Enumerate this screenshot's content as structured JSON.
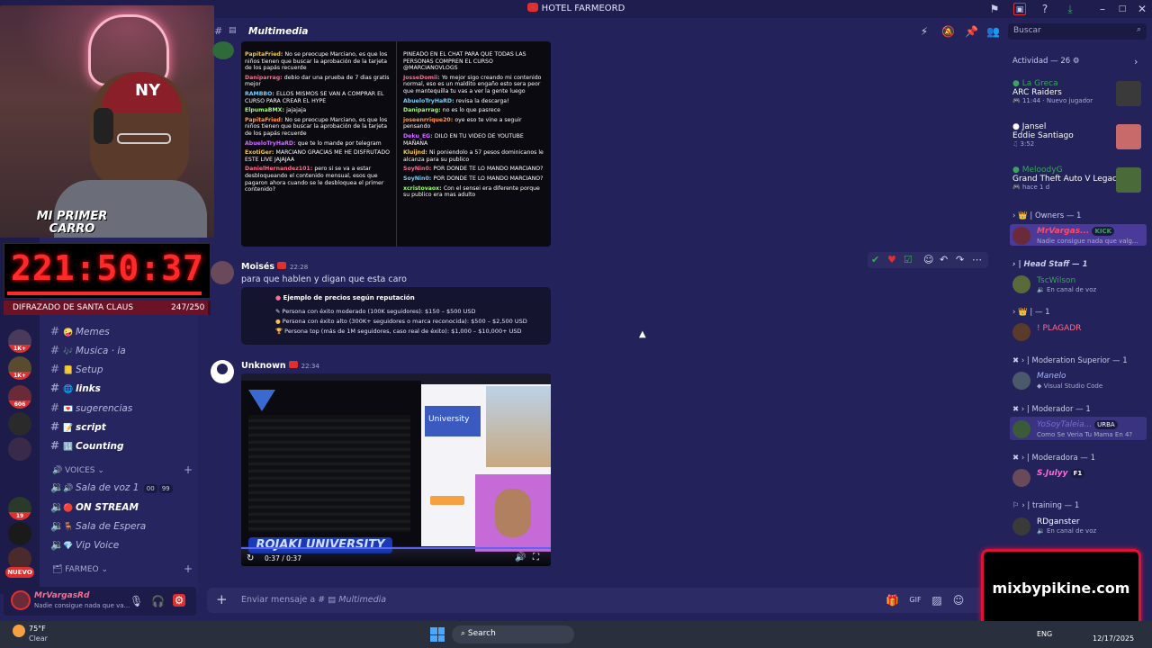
{
  "window": {
    "title": "HOTEL FARMEORD"
  },
  "channel_header": {
    "name": "Multimedia",
    "search_placeholder": "Buscar"
  },
  "stream_overlay": {
    "banner": "MI PRIMER CARRO",
    "timer": "221:50:37",
    "goal_label": "DIFRAZADO DE SANTA CLAUS",
    "goal_progress": "247/250",
    "goal_fraction": 0.988
  },
  "server_rail": {
    "badges": [
      "1K+",
      "1K+",
      "606",
      "19"
    ],
    "new_label": "NUEVO"
  },
  "channels": [
    {
      "emoji": "🤪",
      "name": "Memes",
      "bold": false
    },
    {
      "emoji": "🎶",
      "name": "Musica · ia",
      "bold": false
    },
    {
      "emoji": "📒",
      "name": "Setup",
      "bold": false
    },
    {
      "emoji": "🌐",
      "name": "links",
      "bold": true
    },
    {
      "emoji": "💌",
      "name": "sugerencias",
      "bold": false
    },
    {
      "emoji": "📝",
      "name": "script",
      "bold": true
    },
    {
      "emoji": "🔢",
      "name": "Counting",
      "bold": true
    }
  ],
  "voices_category": "VOICES",
  "voice_channels": [
    {
      "emoji": "🔊",
      "name": "Sala de voz 1",
      "count_a": "00",
      "count_b": "99"
    },
    {
      "emoji": "🔴",
      "name": "ON STREAM"
    },
    {
      "emoji": "🪑",
      "name": "Sala de Espera"
    },
    {
      "emoji": "💎",
      "name": "Vip Voice"
    }
  ],
  "farmeo_category": "FARMEO",
  "chat_log_left": [
    {
      "user": "PapitaFried",
      "text": "No se preocupe Marciano, es que los niños tienen que buscar la aprobación de la tarjeta de los papás recuerde"
    },
    {
      "user": "Daniparrag",
      "text": "debio dar una prueba de 7 dias gratis mejor"
    },
    {
      "user": "RAMBBO",
      "text": "ELLOS MISMOS SE VAN A COMPRAR EL CURSO PARA CREAR EL HYPE"
    },
    {
      "user": "ElpumaBMX",
      "text": "jajajaja"
    },
    {
      "user": "PapitaFried",
      "text": "No se preocupe Marciano, es que los niños tienen que buscar la aprobación de la tarjeta de los papás recuerde"
    },
    {
      "user": "AbueloTryHaRD",
      "text": "que te lo mande por telegram"
    },
    {
      "user": "ExotiGer",
      "text": "MARCIANO GRACIAS ME HE DISFRUTADO ESTE LIVE JAJAJAA"
    },
    {
      "user": "DanielHernandez101",
      "text": "pero si se va a estar desbloqueando el contenido mensual, esos que pagaron ahora cuando se le desbloquea el primer contenido?"
    }
  ],
  "chat_log_right": [
    {
      "user": "",
      "text": "PINEADO EN EL CHAT PARA QUE TODAS LAS PERSONAS COMPREN EL CURSO @MARCIANOVLOGS"
    },
    {
      "user": "JosseDomii",
      "text": "Yo mejor sigo creando mi contenido normal, eso es un maldito engaño esto sera peor que mantequilla tu vas a ver la gente luego"
    },
    {
      "user": "AbueloTryHaRD",
      "text": "revisa la descarga!"
    },
    {
      "user": "Daniparrag",
      "text": "no es lo que pasrece"
    },
    {
      "user": "joseenrrique20",
      "text": "oye eso te vine a seguir pensando"
    },
    {
      "user": "Deku_EG",
      "text": "DILO EN TU VIDEO DE YOUTUBE MAÑANA"
    },
    {
      "user": "Kluijnd",
      "text": "Ni poniendolo a 57 pesos dominicanos le alcanza para su publico"
    },
    {
      "user": "SoyNin0",
      "text": "POR DONDE TE LO MANDO MARCIANO?"
    },
    {
      "user": "SoyNin0",
      "text": "POR DONDE TE LO MANDO MARCIANO?"
    },
    {
      "user": "xcristovaox",
      "text": "Con el sensei era diferente porque su publico era mas adulto"
    }
  ],
  "messages": [
    {
      "author": "Moisés",
      "time": "22:28",
      "text": "para que hablen y digan que esta caro"
    },
    {
      "author": "Unknown",
      "time": "22:34",
      "text": ""
    }
  ],
  "price_card": {
    "title": "Ejemplo de precios según reputación",
    "rows": [
      "Persona con éxito moderado (100K seguidores): $150 – $500 USD",
      "Persona con éxito alto (300K+ seguidores o marca reconocida): $500 – $2,500 USD",
      "Persona top (más de 1M seguidores, caso real de éxito): $1,000 – $10,000+ USD"
    ]
  },
  "video": {
    "time": "0:37 / 0:37",
    "banner": "ROJAKI UNIVERSITY",
    "site_title": "University"
  },
  "composer": {
    "placeholder_prefix": "Enviar mensaje a #",
    "placeholder_channel": "Multimedia"
  },
  "user_panel": {
    "name": "MrVargasRd",
    "status": "Nadie consigue nada que va..."
  },
  "activity": {
    "header": "Actividad — 26",
    "items": [
      {
        "user": "La Greca",
        "game": "ARC Raiders",
        "meta": "11:44",
        "extra": "Nuevo jugador"
      },
      {
        "user": "Jansel",
        "game": "Eddie Santiago",
        "meta": "3:52",
        "extra": ""
      },
      {
        "user": "MeloodyG",
        "game": "Grand Theft Auto V Legacy",
        "meta": "hace 1 d",
        "extra": ""
      }
    ]
  },
  "member_groups": [
    {
      "label": "Owners — 1",
      "members": [
        {
          "name": "MrVargas...",
          "sub": "Nadie consigue nada que valg...",
          "tag": "KICK"
        }
      ]
    },
    {
      "label": "Head Staff — 1",
      "members": [
        {
          "name": "TscWilson",
          "sub": "En canal de voz",
          "tag": ""
        }
      ]
    },
    {
      "label": "— 1",
      "members": [
        {
          "name": "! PLAGADR",
          "sub": "",
          "tag": ""
        }
      ]
    },
    {
      "label": "Moderation Superior — 1",
      "members": [
        {
          "name": "Manelo",
          "sub": "Visual Studio Code",
          "tag": ""
        }
      ]
    },
    {
      "label": "Moderador — 1",
      "members": [
        {
          "name": "YoSoyTaleia...",
          "sub": "Como Se Veria Tu Mama En 4?",
          "tag": "URBA"
        }
      ]
    },
    {
      "label": "Moderadora — 1",
      "members": [
        {
          "name": "S.Julyy",
          "sub": "",
          "tag": "F1"
        }
      ]
    },
    {
      "label": "training — 1",
      "members": [
        {
          "name": "RDganster",
          "sub": "En canal de voz",
          "tag": ""
        }
      ]
    }
  ],
  "watermark": "mixbypikine.com",
  "taskbar": {
    "weather_temp": "75°F",
    "weather_desc": "Clear",
    "search_label": "Search",
    "lang": "ENG",
    "date": "12/17/2025"
  },
  "colors": {
    "accent": "#e0302e",
    "bg": "#23225a",
    "timer": "#ff2a2a"
  }
}
